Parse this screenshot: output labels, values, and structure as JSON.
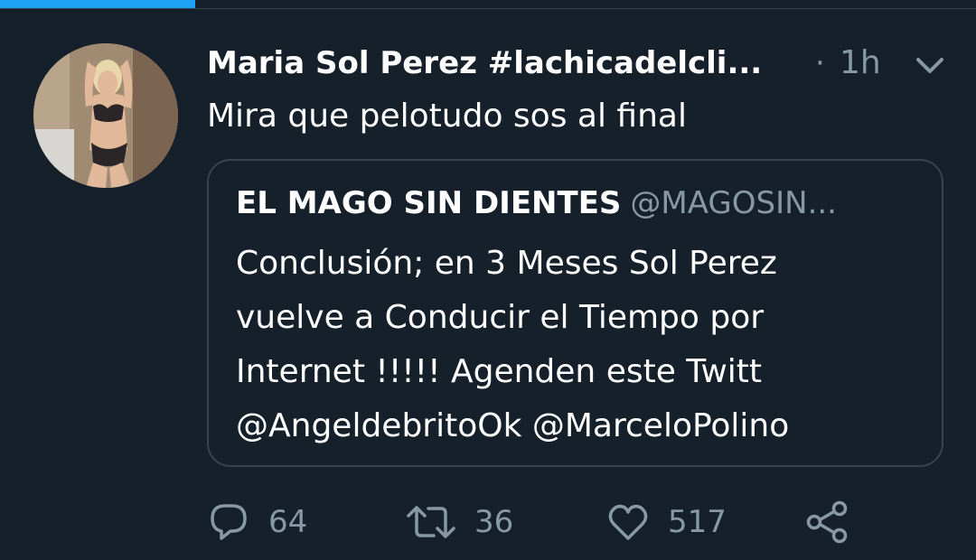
{
  "progress": {
    "fraction": 0.2
  },
  "tweet": {
    "author_name": "Maria Sol Perez #lachicadelcli...",
    "separator": "·",
    "time": "1h",
    "text": "Mira que pelotudo sos al final",
    "avatar": "profile-photo"
  },
  "quote": {
    "name": "EL MAGO SIN DIENTES",
    "handle": "@MAGOSIN...",
    "lines": [
      "Conclusión; en 3 Meses Sol Perez",
      "vuelve a Conducir el Tiempo por",
      "Internet !!!!! Agenden este Twitt",
      "@AngeldebritoOk @MarceloPolino"
    ]
  },
  "actions": {
    "reply": {
      "icon": "reply-icon",
      "count": "64"
    },
    "retweet": {
      "icon": "retweet-icon",
      "count": "36"
    },
    "like": {
      "icon": "heart-icon",
      "count": "517"
    },
    "share": {
      "icon": "share-icon"
    }
  },
  "colors": {
    "background": "#15202b",
    "accent": "#1da1f2",
    "secondary_text": "#8899a6",
    "border": "#38444d"
  }
}
